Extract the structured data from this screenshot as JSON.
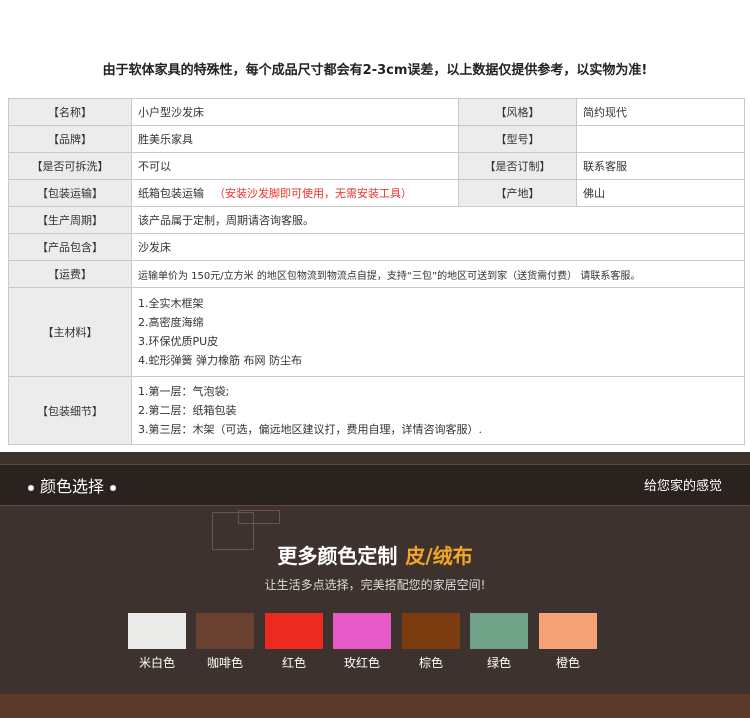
{
  "notice": "由于软体家具的特殊性，每个成品尺寸都会有2-3cm误差，以上数据仅提供参考，以实物为准!",
  "specs": {
    "name_label": "【名称】",
    "name_value": "小户型沙发床",
    "style_label": "【风格】",
    "style_value": "简约现代",
    "brand_label": "【品牌】",
    "brand_value": "胜美乐家具",
    "model_label": "【型号】",
    "model_value": "",
    "washable_label": "【是否可拆洗】",
    "washable_value": "不可以",
    "custom_label": "【是否订制】",
    "custom_value": "联系客服",
    "packaging_label": "【包装运输】",
    "packaging_value": "纸箱包装运输",
    "packaging_note": "（安装沙发脚即可使用，无需安装工具）",
    "origin_label": "【产地】",
    "origin_value": "佛山",
    "cycle_label": "【生产周期】",
    "cycle_value": "该产品属于定制，周期请咨询客服。",
    "includes_label": "【产品包含】",
    "includes_value": "沙发床",
    "shipping_label": "【运费】",
    "shipping_value": "运输单价为 150元/立方米 的地区包物流到物流点自提，支持“三包”的地区可送到家（送货需付费） 请联系客服。",
    "materials_label": "【主材料】",
    "materials": [
      "1.全实木框架",
      "2.高密度海绵",
      "3.环保优质PU皮",
      "4.蛇形弹簧 弹力橡筋 布网 防尘布"
    ],
    "pack_detail_label": "【包装细节】",
    "pack_details": [
      "1.第一层：气泡袋;",
      "2.第二层：纸箱包装",
      "3.第三层：木架（可选，偏远地区建议打，费用自理，详情咨询客服）."
    ]
  },
  "color_section": {
    "title": "颜色选择",
    "tagline": "给您家的感觉",
    "headline": "更多颜色定制",
    "headline_highlight": "皮/绒布",
    "subheadline": "让生活多点选择，完美搭配您的家居空间!",
    "swatches": [
      {
        "name": "米白色",
        "color": "#ebebea"
      },
      {
        "name": "咖啡色",
        "color": "#6a4131"
      },
      {
        "name": "红色",
        "color": "#ec2b20"
      },
      {
        "name": "玫红色",
        "color": "#e85ac8"
      },
      {
        "name": "棕色",
        "color": "#7c3c10"
      },
      {
        "name": "绿色",
        "color": "#6fa388"
      },
      {
        "name": "橙色",
        "color": "#f6a277"
      }
    ]
  }
}
